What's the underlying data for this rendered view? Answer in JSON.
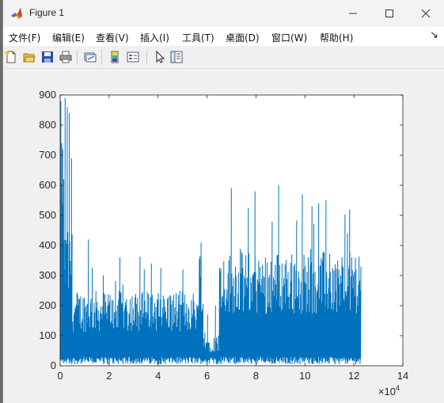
{
  "window": {
    "title": "Figure 1"
  },
  "menu": {
    "items": [
      {
        "label": "文件(F)",
        "name": "menu-file"
      },
      {
        "label": "编辑(E)",
        "name": "menu-edit"
      },
      {
        "label": "查看(V)",
        "name": "menu-view"
      },
      {
        "label": "插入(I)",
        "name": "menu-insert"
      },
      {
        "label": "工具(T)",
        "name": "menu-tools"
      },
      {
        "label": "桌面(D)",
        "name": "menu-desktop"
      },
      {
        "label": "窗口(W)",
        "name": "menu-window"
      },
      {
        "label": "帮助(H)",
        "name": "menu-help"
      }
    ],
    "dock_arrow": "↘"
  },
  "toolbar": {
    "icons": [
      "new-figure-icon",
      "open-file-icon",
      "save-icon",
      "print-icon",
      "link-plot-icon",
      "colorbar-icon",
      "legend-icon",
      "pointer-icon",
      "property-inspector-icon"
    ]
  },
  "colors": {
    "series": "#0072bd",
    "axes_bg": "#ffffff",
    "figure_bg": "#f0f0f0"
  },
  "chart_data": {
    "type": "line",
    "title": "",
    "xlabel": "",
    "ylabel": "",
    "xlim": [
      0,
      140000
    ],
    "ylim": [
      0,
      900
    ],
    "x_exponent_label": "×10",
    "x_exponent_power": "4",
    "xticks": [
      0,
      20000,
      40000,
      60000,
      80000,
      100000,
      120000,
      140000
    ],
    "xtick_labels": [
      "0",
      "2",
      "4",
      "6",
      "8",
      "10",
      "12",
      "14"
    ],
    "yticks": [
      0,
      100,
      200,
      300,
      400,
      500,
      600,
      700,
      800,
      900
    ],
    "ytick_labels": [
      "0",
      "100",
      "200",
      "300",
      "400",
      "500",
      "600",
      "700",
      "800",
      "900"
    ],
    "grid": false,
    "series": [
      {
        "x_start": 0,
        "x_end": 123000,
        "segments": [
          {
            "x": [
              0,
              1500
            ],
            "typical_high": 600,
            "peaks": [
              880,
              740,
              720,
              620
            ]
          },
          {
            "x": [
              1500,
              5000
            ],
            "typical_high": 450,
            "peaks": [
              890,
              860,
              840,
              690
            ]
          },
          {
            "x": [
              5000,
              56500
            ],
            "typical_high": 250,
            "peaks": [
              420,
              360,
              340,
              320
            ]
          },
          {
            "x": [
              56500,
              58500
            ],
            "typical_high": 400,
            "peaks": [
              410
            ]
          },
          {
            "x": [
              58500,
              65000
            ],
            "typical_high": 100,
            "peaks": [
              170,
              200
            ]
          },
          {
            "x": [
              65000,
              123000
            ],
            "typical_high": 380,
            "peaks": [
              590,
              580,
              600,
              570,
              550,
              520
            ]
          }
        ]
      }
    ]
  }
}
